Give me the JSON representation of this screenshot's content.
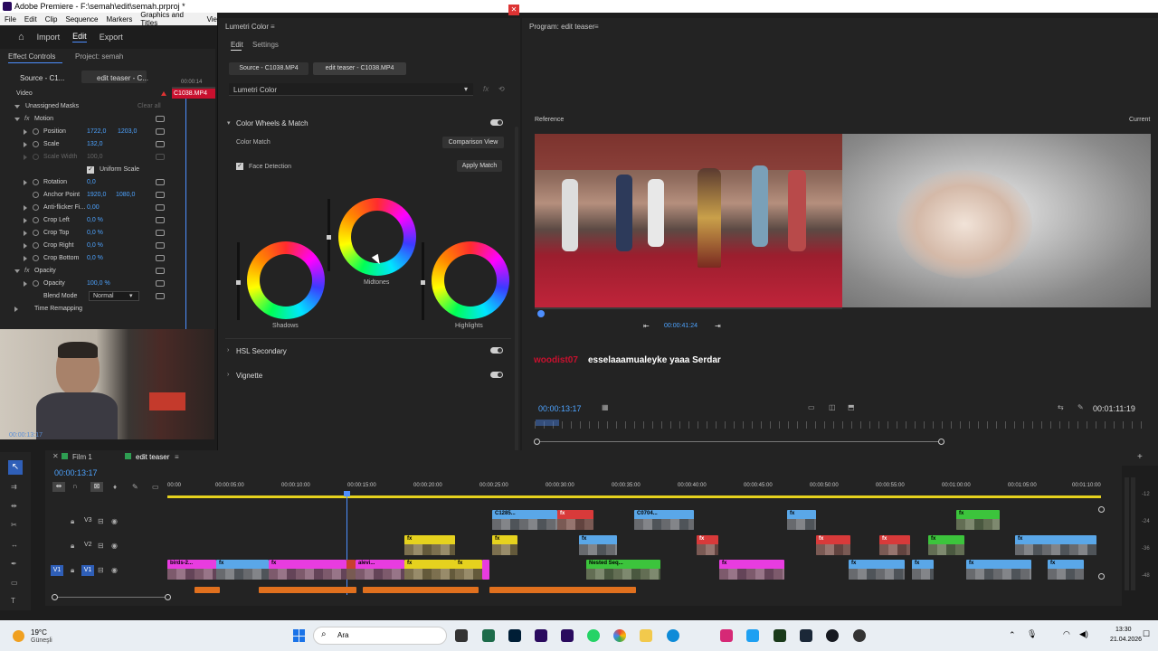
{
  "window": {
    "title": "Adobe Premiere - F:\\semah\\edit\\semah.prproj *"
  },
  "menu": [
    "File",
    "Edit",
    "Clip",
    "Sequence",
    "Markers",
    "Graphics and Titles",
    "Vie"
  ],
  "workspace": {
    "items": [
      "Import",
      "Edit",
      "Export"
    ],
    "active": "Edit"
  },
  "effect_controls": {
    "tab": "Effect Controls",
    "tab2": "Project: semah",
    "source_tab": "Source - C1...",
    "seq_tab": "edit teaser - C...",
    "clip_name": "C1038.MP4",
    "timecode_mini": "00:00:14",
    "section": "Video",
    "masks": "Unassigned Masks",
    "clear_all": "Clear all",
    "rows": [
      {
        "label": "Motion"
      },
      {
        "label": "Position",
        "v1": "1722,0",
        "v2": "1203,0"
      },
      {
        "label": "Scale",
        "v1": "132,0"
      },
      {
        "label": "Scale Width",
        "v1": "100,0"
      },
      {
        "label": "Uniform Scale"
      },
      {
        "label": "Rotation",
        "v1": "0,0"
      },
      {
        "label": "Anchor Point",
        "v1": "1920,0",
        "v2": "1080,0"
      },
      {
        "label": "Anti-flicker Fi...",
        "v1": "0,00"
      },
      {
        "label": "Crop Left",
        "v1": "0,0 %"
      },
      {
        "label": "Crop Top",
        "v1": "0,0 %"
      },
      {
        "label": "Crop Right",
        "v1": "0,0 %"
      },
      {
        "label": "Crop Bottom",
        "v1": "0,0 %"
      },
      {
        "label": "Opacity"
      },
      {
        "label": "Opacity",
        "v1": "100,0 %"
      },
      {
        "label": "Blend Mode",
        "v1": "Normal"
      },
      {
        "label": "Time Remapping"
      }
    ],
    "webcam_time": "00:00:13:17"
  },
  "lumetri": {
    "title": "Lumetri Color",
    "tabs": [
      "Edit",
      "Settings"
    ],
    "source_btn": "Source - C1038.MP4",
    "seq_btn": "edit teaser - C1038.MP4",
    "effect_select": "Lumetri Color",
    "section": "Color Wheels & Match",
    "color_match": "Color Match",
    "comparison_view": "Comparison View",
    "face_detection": "Face Detection",
    "apply_match": "Apply Match",
    "wheels": [
      "Shadows",
      "Midtones",
      "Highlights"
    ],
    "hsl": "HSL Secondary",
    "vignette": "Vignette"
  },
  "program": {
    "title": "Program: edit teaser",
    "reference": "Reference",
    "current": "Current",
    "ref_timecode": "00:00:41:24",
    "chat_user": "woodist07",
    "chat_message": "esselaaamualeyke yaaa Serdar",
    "timecode": "00:00:13:17",
    "duration": "00:01:11:19"
  },
  "timeline": {
    "tabs": [
      "Film 1",
      "edit teaser"
    ],
    "timecode": "00:00:13:17",
    "ruler": [
      "00:00",
      "00:00:05:00",
      "00:00:10:00",
      "00:00:15:00",
      "00:00:20:00",
      "00:00:25:00",
      "00:00:30:00",
      "00:00:35:00",
      "00:00:40:00",
      "00:00:45:00",
      "00:00:50:00",
      "00:00:55:00",
      "00:01:00:00",
      "00:01:05:00",
      "00:01:10:00"
    ],
    "tracks": [
      "V3",
      "V2",
      "V1"
    ],
    "clip_labels": [
      "C1285...",
      "C0704...",
      "birds-2...",
      "alevi...",
      "Nested Seq..."
    ],
    "meter": [
      "-12",
      "-24",
      "-36",
      "-48"
    ]
  },
  "taskbar": {
    "temp": "19°C",
    "weather": "Güneşli",
    "search": "Ara",
    "time": "13:30",
    "date": "21.04.2026"
  }
}
